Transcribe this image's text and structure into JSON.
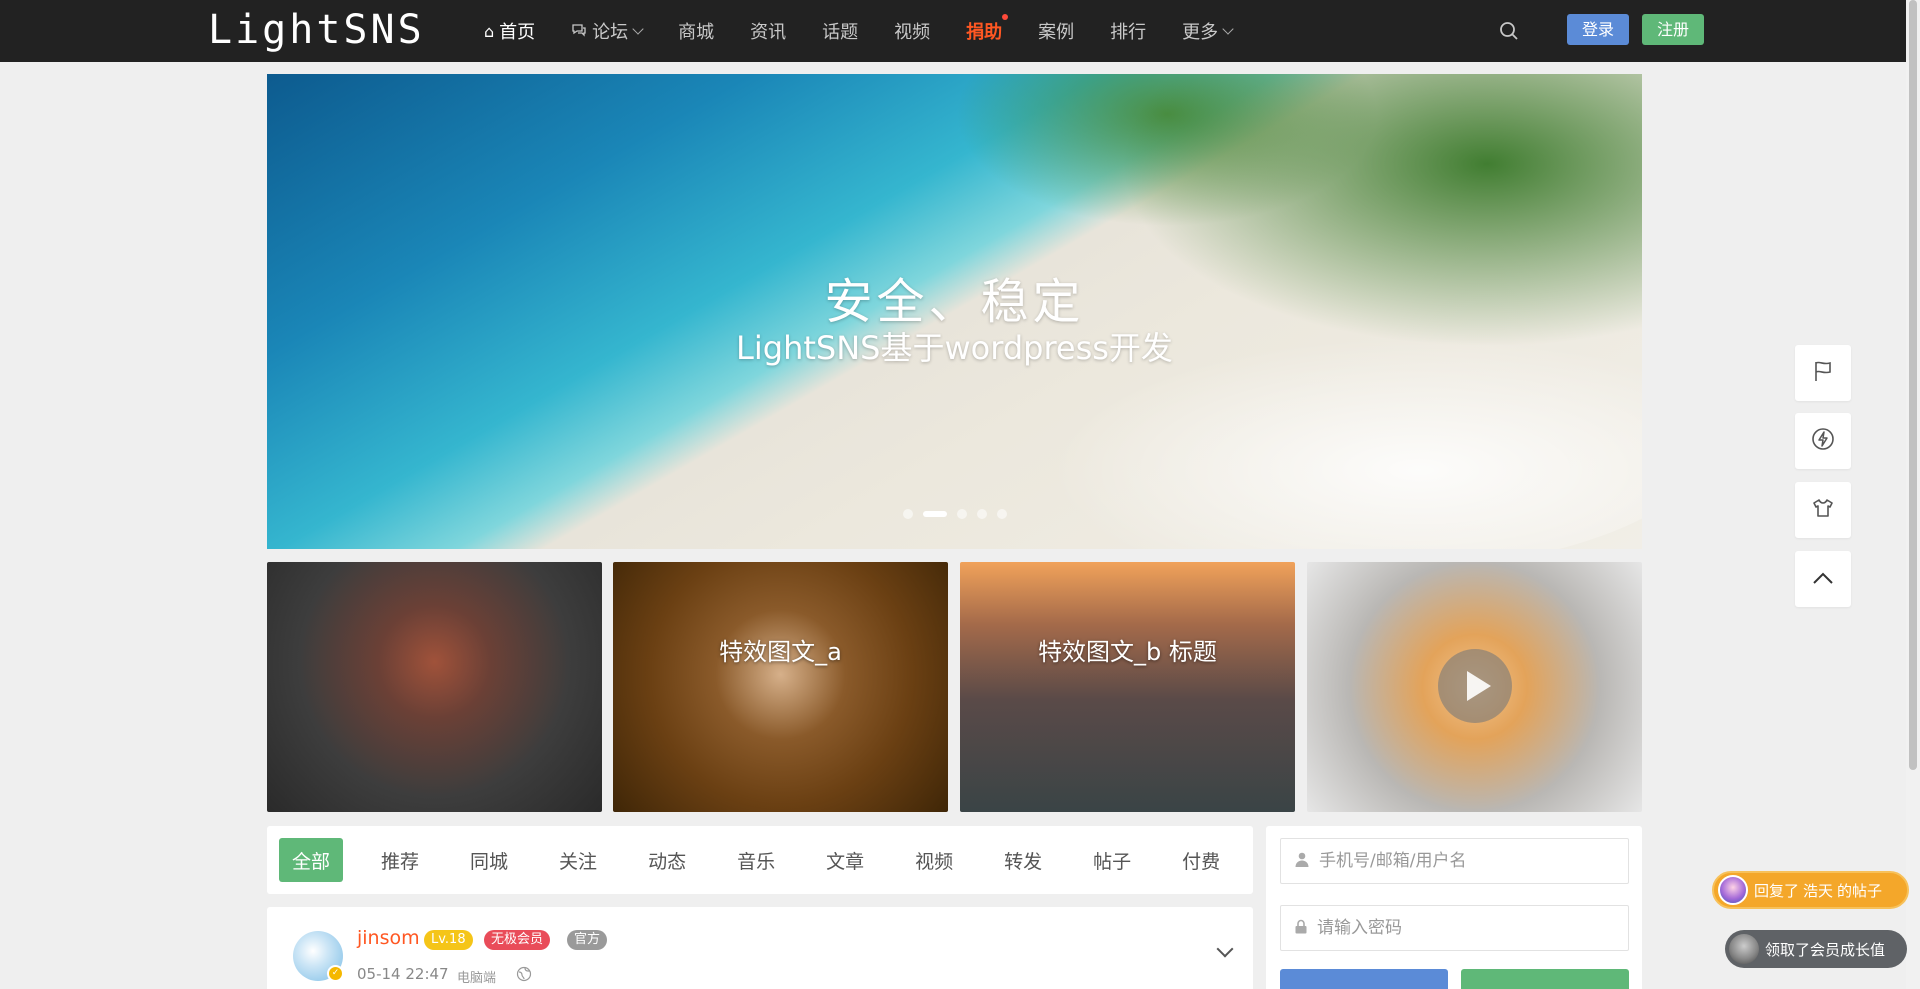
{
  "header": {
    "logo": "LightSNS",
    "nav": [
      {
        "label": "首页",
        "icon": "home-icon",
        "active": true
      },
      {
        "label": "论坛",
        "icon": "chat-bubbles-icon",
        "dropdown": true
      },
      {
        "label": "商城"
      },
      {
        "label": "资讯"
      },
      {
        "label": "话题"
      },
      {
        "label": "视频"
      },
      {
        "label": "捐助",
        "highlight": true,
        "dot": true
      },
      {
        "label": "案例"
      },
      {
        "label": "排行"
      },
      {
        "label": "更多",
        "dropdown": true
      }
    ],
    "login_label": "登录",
    "register_label": "注册"
  },
  "banner": {
    "title": "安全、稳定",
    "subtitle": "LightSNS基于wordpress开发",
    "slide_count": 5,
    "active_slide": 2
  },
  "thumbnails": [
    {
      "caption": ""
    },
    {
      "caption": "特效图文_a"
    },
    {
      "caption": "特效图文_b 标题"
    },
    {
      "caption": "",
      "video": true
    }
  ],
  "feed_tabs": [
    "全部",
    "推荐",
    "同城",
    "关注",
    "动态",
    "音乐",
    "文章",
    "视频",
    "转发",
    "帖子",
    "付费"
  ],
  "post": {
    "username": "jinsom",
    "level": "Lv.18",
    "vip": "无极会员",
    "official": "官方",
    "time": "05-14 22:47",
    "device": "电脑端"
  },
  "login_panel": {
    "account_placeholder": "手机号/邮箱/用户名",
    "password_placeholder": "请输入密码"
  },
  "float_bar": [
    "flag-icon",
    "lightning-icon",
    "shirt-icon",
    "back-to-top-icon"
  ],
  "notifications": [
    {
      "prefix": "回复了",
      "name": "浩天",
      "suffix": "的帖子"
    },
    {
      "text": "领取了会员成长值"
    }
  ],
  "colors": {
    "header_bg": "#222222",
    "primary_green": "#5fb878",
    "primary_blue": "#5b8bd7",
    "accent_orange": "#ff5722"
  }
}
